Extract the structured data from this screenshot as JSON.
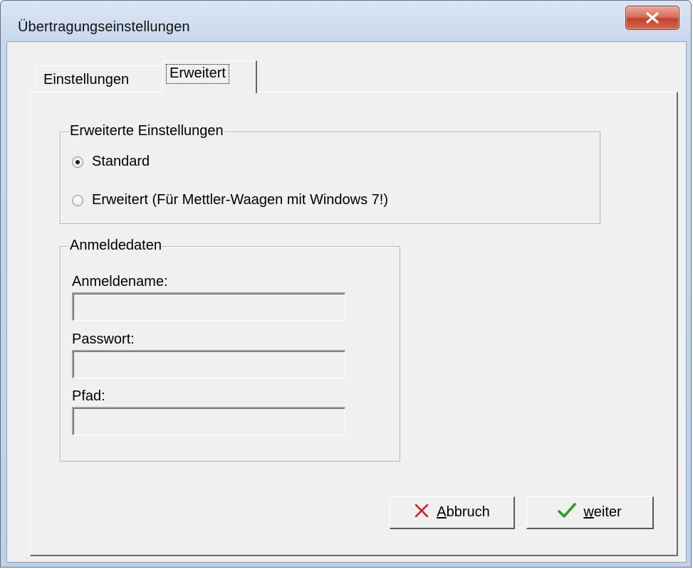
{
  "window": {
    "title": "Übertragungseinstellungen"
  },
  "tabs": [
    {
      "label": "Einstellungen",
      "active": false
    },
    {
      "label": "Erweitert",
      "active": true
    }
  ],
  "advanced_group": {
    "title": "Erweiterte Einstellungen",
    "options": [
      {
        "label": "Standard",
        "checked": true
      },
      {
        "label": "Erweitert (Für Mettler-Waagen mit Windows 7!)",
        "checked": false
      }
    ]
  },
  "login_group": {
    "title": "Anmeldedaten",
    "fields": [
      {
        "label": "Anmeldename:",
        "value": ""
      },
      {
        "label": "Passwort:",
        "value": ""
      },
      {
        "label": "Pfad:",
        "value": ""
      }
    ]
  },
  "buttons": {
    "cancel": {
      "mnemonic": "A",
      "rest": "bbruch",
      "icon": "red-x-icon"
    },
    "next": {
      "mnemonic": "w",
      "rest": "eiter",
      "icon": "green-check-icon"
    }
  },
  "colors": {
    "cancel_icon": "#cc1f1f",
    "next_icon": "#2e9e1f",
    "close_button": "#c2432c"
  }
}
